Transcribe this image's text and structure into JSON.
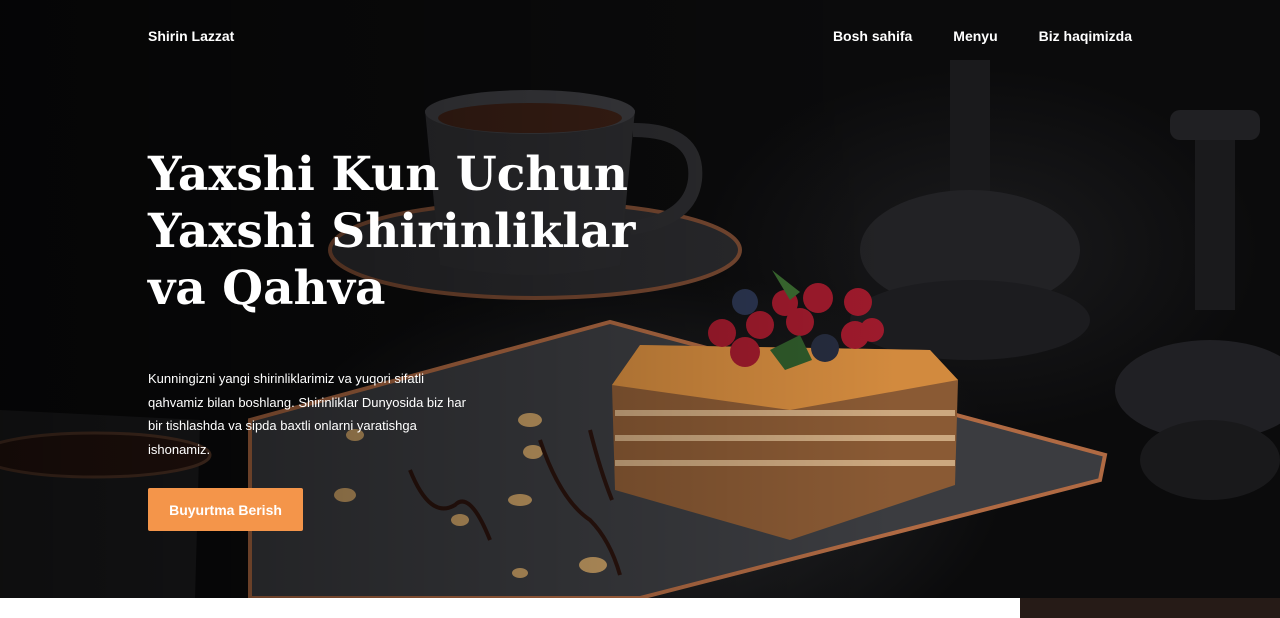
{
  "header": {
    "brand": "Shirin Lazzat",
    "nav": [
      {
        "label": "Bosh sahifa"
      },
      {
        "label": "Menyu"
      },
      {
        "label": "Biz haqimizda"
      }
    ]
  },
  "hero": {
    "headline": "Yaxshi Kun Uchun Yaxshi Shirinliklar va Qahva",
    "subtext": "Kunningizni yangi shirinliklarimiz va yuqori sifatli qahvamiz bilan boshlang. Shirinliklar Dunyosida biz har bir tishlashda va sipda baxtli onlarni yaratishga ishonamiz.",
    "cta_label": "Buyurtma Berish",
    "background_image": "cake-and-coffee-photo"
  },
  "colors": {
    "accent": "#f4954a",
    "hero_background": "#0b0b0c",
    "text": "#ffffff",
    "footer_strip_dark": "#261b17"
  }
}
